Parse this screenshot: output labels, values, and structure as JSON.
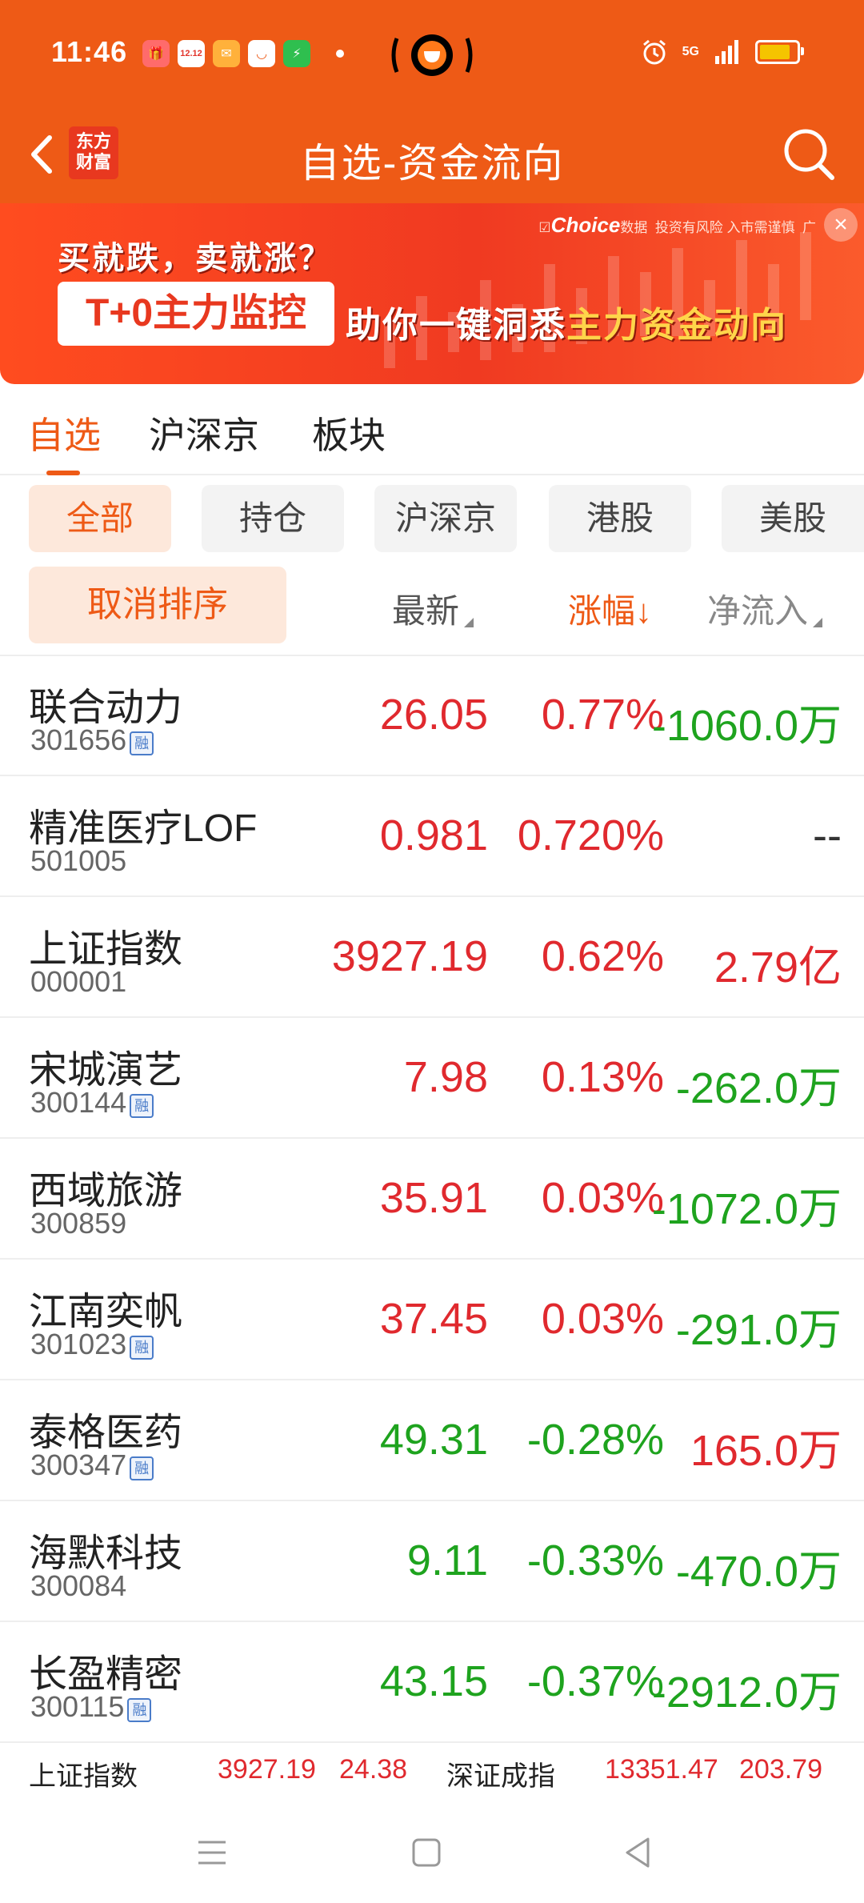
{
  "status_bar": {
    "time": "11:46",
    "app_icons": [
      "app-icon-1",
      "app-icon-2",
      "app-icon-3",
      "app-icon-4",
      "app-icon-5"
    ],
    "app_icon_texts": [
      "🎁",
      "12.12",
      "✉",
      "◡",
      "⚡"
    ],
    "network": "5G",
    "battery_level": 0.85
  },
  "header": {
    "title": "自选-资金流向",
    "brand_logo": "东方财富",
    "brand_logo_line1": "东方",
    "brand_logo_line2": "财富"
  },
  "banner": {
    "source": "Choice数据",
    "source_brand": "Choice",
    "source_suffix": "数据",
    "disclaimer": "投资有风险 入市需谨慎",
    "ad_mark": "广",
    "question": "买就跌，卖就涨？",
    "tag": "T+0主力监控",
    "slogan_prefix": "助你一键洞悉",
    "slogan_highlight": "主力资金动向"
  },
  "main_tabs": [
    {
      "label": "自选",
      "active": true
    },
    {
      "label": "沪深京",
      "active": false
    },
    {
      "label": "板块",
      "active": false
    }
  ],
  "filter_chips": [
    {
      "label": "全部",
      "active": true
    },
    {
      "label": "持仓",
      "active": false
    },
    {
      "label": "沪深京",
      "active": false
    },
    {
      "label": "港股",
      "active": false
    },
    {
      "label": "美股",
      "active": false
    }
  ],
  "sort_bar": {
    "cancel_label": "取消排序",
    "col_price": "最新",
    "col_change": "涨幅",
    "col_change_arrow": "↓",
    "col_net": "净流入"
  },
  "margin_badge_text": "融",
  "stocks": [
    {
      "name": "联合动力",
      "code": "301656",
      "margin": true,
      "price": "26.05",
      "change": "0.77%",
      "net": "-1060.0万",
      "price_dir": "up",
      "change_dir": "up",
      "net_dir": "down"
    },
    {
      "name": "精准医疗LOF",
      "code": "501005",
      "margin": false,
      "price": "0.981",
      "change": "0.720%",
      "net": "--",
      "price_dir": "up",
      "change_dir": "up",
      "net_dir": "flat"
    },
    {
      "name": "上证指数",
      "code": "000001",
      "margin": false,
      "price": "3927.19",
      "change": "0.62%",
      "net": "2.79亿",
      "price_dir": "up",
      "change_dir": "up",
      "net_dir": "up"
    },
    {
      "name": "宋城演艺",
      "code": "300144",
      "margin": true,
      "price": "7.98",
      "change": "0.13%",
      "net": "-262.0万",
      "price_dir": "up",
      "change_dir": "up",
      "net_dir": "down"
    },
    {
      "name": "西域旅游",
      "code": "300859",
      "margin": false,
      "price": "35.91",
      "change": "0.03%",
      "net": "-1072.0万",
      "price_dir": "up",
      "change_dir": "up",
      "net_dir": "down"
    },
    {
      "name": "江南奕帆",
      "code": "301023",
      "margin": true,
      "price": "37.45",
      "change": "0.03%",
      "net": "-291.0万",
      "price_dir": "up",
      "change_dir": "up",
      "net_dir": "down"
    },
    {
      "name": "泰格医药",
      "code": "300347",
      "margin": true,
      "price": "49.31",
      "change": "-0.28%",
      "net": "165.0万",
      "price_dir": "down",
      "change_dir": "down",
      "net_dir": "up"
    },
    {
      "name": "海默科技",
      "code": "300084",
      "margin": false,
      "price": "9.11",
      "change": "-0.33%",
      "net": "-470.0万",
      "price_dir": "down",
      "change_dir": "down",
      "net_dir": "down"
    },
    {
      "name": "长盈精密",
      "code": "300115",
      "margin": true,
      "price": "43.15",
      "change": "-0.37%",
      "net": "-2912.0万",
      "price_dir": "down",
      "change_dir": "down",
      "net_dir": "down"
    }
  ],
  "ticker": {
    "sh_label": "上证指数",
    "sh_price": "3927.19",
    "sh_change": "24.38",
    "sz_label": "深证成指",
    "sz_price": "13351.47",
    "sz_change": "203.79"
  },
  "colors": {
    "brand": "#ee5a16",
    "up": "#e0292e",
    "down": "#1ea31e"
  },
  "nav_icons": [
    "menu-icon",
    "home-icon",
    "back-icon"
  ]
}
